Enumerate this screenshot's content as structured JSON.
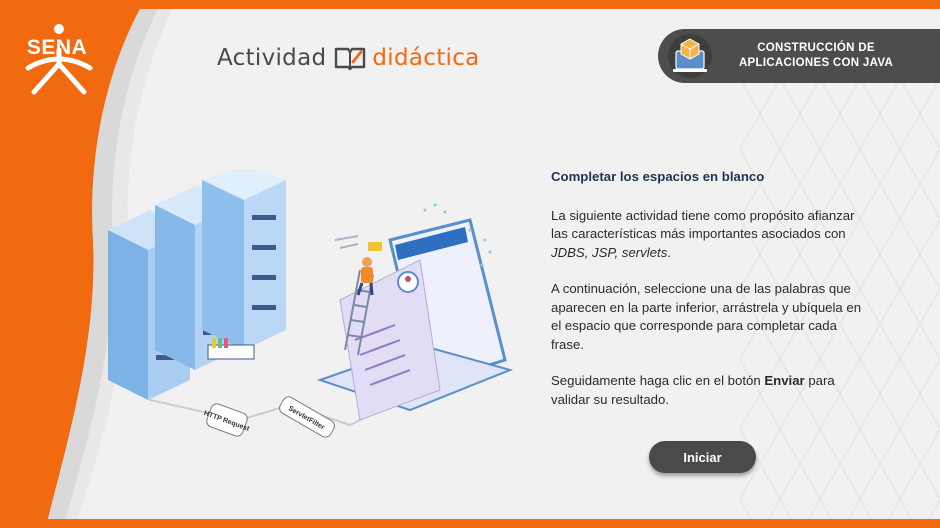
{
  "brand": {
    "logo_text": "SENA"
  },
  "header": {
    "title_part1": "Actividad",
    "title_part2": "didáctica",
    "course_line1": "CONSTRUCCIÓN DE",
    "course_line2": "APLICACIONES CON JAVA"
  },
  "main": {
    "heading": "Completar los espacios en blanco",
    "para1_before": "La siguiente actividad tiene como propósito afianzar las características más importantes asociados con ",
    "para1_italic": "JDBS, JSP, servlets",
    "para1_after": ".",
    "para2": "A continuación, seleccione una de las palabras que aparecen en la parte inferior, arrástrela y ubíquela en el espacio que corresponde para completar cada frase.",
    "para3_before": "Seguidamente haga clic en el botón ",
    "para3_bold": "Enviar",
    "para3_after": " para validar su resultado.",
    "start_button": "Iniciar"
  },
  "illustration": {
    "label_http": "HTTP Request",
    "label_filter": "ServletFilter"
  },
  "colors": {
    "accent": "#f26a10",
    "dark": "#4d4d4d",
    "heading": "#1f3352"
  }
}
